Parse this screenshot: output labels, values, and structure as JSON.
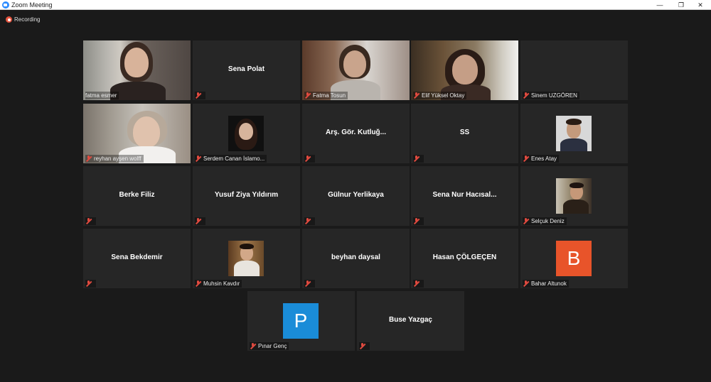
{
  "window": {
    "title": "Zoom Meeting",
    "controls": {
      "minimize": "—",
      "maximize": "❐",
      "close": "✕"
    }
  },
  "recording": {
    "label": "Recording"
  },
  "participants": [
    {
      "name": "fatma esmer",
      "display": "video",
      "active": true
    },
    {
      "name": "Sena Polat",
      "display": "name"
    },
    {
      "name": "Fatma Tosun",
      "display": "video"
    },
    {
      "name": "Elif Yüksel Oktay",
      "display": "video"
    },
    {
      "name": "Sinem UZGÖREN",
      "display": "blank"
    },
    {
      "name": "reyhan ayşen wolff",
      "display": "video"
    },
    {
      "name": "Serdem Canan İslamo...",
      "display": "photo"
    },
    {
      "name": "Arş. Gör. Kutluğ...",
      "display": "name"
    },
    {
      "name": "SS",
      "display": "name"
    },
    {
      "name": "Enes Atay",
      "display": "photo"
    },
    {
      "name": "Berke Filiz",
      "display": "name"
    },
    {
      "name": "Yusuf Ziya Yıldırım",
      "display": "name"
    },
    {
      "name": "Gülnur Yerlikaya",
      "display": "name"
    },
    {
      "name": "Sena  Nur  Hacısal...",
      "display": "name"
    },
    {
      "name": "Selçuk Deniz",
      "display": "photo"
    },
    {
      "name": "Sena Bekdemir",
      "display": "name"
    },
    {
      "name": "Muhsin Kavdır",
      "display": "photo"
    },
    {
      "name": "beyhan daysal",
      "display": "name"
    },
    {
      "name": "Hasan ÇÖLGEÇEN",
      "display": "name"
    },
    {
      "name": "Bahar Altunok",
      "display": "letter",
      "letter": "B",
      "color": "#e8542a"
    },
    {
      "name": "Pınar Genç",
      "display": "letter",
      "letter": "P",
      "color": "#1a8cd8"
    },
    {
      "name": "Buse Yazgaç",
      "display": "name"
    }
  ],
  "colors": {
    "background": "#1a1a1a",
    "tile": "#262626",
    "active_border": "#c9e64b",
    "muted_mic": "#e04a3f"
  }
}
